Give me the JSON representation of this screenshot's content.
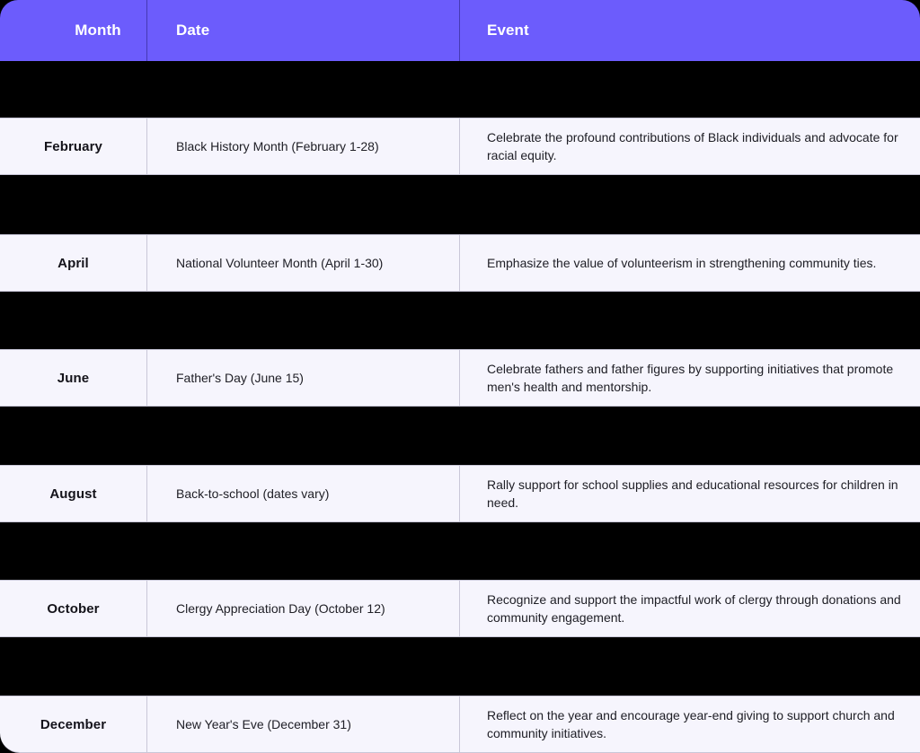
{
  "table": {
    "name": "annual-giving-events-calendar",
    "columns": [
      {
        "key": "month",
        "label": "Month"
      },
      {
        "key": "date",
        "label": "Date"
      },
      {
        "key": "event",
        "label": "Event"
      }
    ],
    "header_background": "#6C5CFC",
    "header_text_color": "#FFFFFF",
    "row_background": "#F6F5FD",
    "row_border_color": "#C9C7D8",
    "body_text_color": "#202027",
    "page_background": "#000000",
    "rows": [
      {
        "month": "February",
        "date": "Black History Month (February 1-28)",
        "event": "Celebrate the profound contributions of Black individuals and advocate for racial equity."
      },
      {
        "month": "April",
        "date": "National Volunteer Month (April 1-30)",
        "event": "Emphasize the value of volunteerism in strengthening community ties."
      },
      {
        "month": "June",
        "date": "Father's Day (June 15)",
        "event": "Celebrate fathers and father figures by supporting initiatives that promote men's health and mentorship."
      },
      {
        "month": "August",
        "date": "Back-to-school (dates vary)",
        "event": "Rally support for school supplies and educational resources for children in need."
      },
      {
        "month": "October",
        "date": "Clergy Appreciation Day (October 12)",
        "event": "Recognize and support the impactful work of clergy through donations and community engagement."
      },
      {
        "month": "December",
        "date": "New Year's Eve (December 31)",
        "event": "Reflect on the year and encourage year-end giving to support church and community initiatives."
      }
    ]
  }
}
